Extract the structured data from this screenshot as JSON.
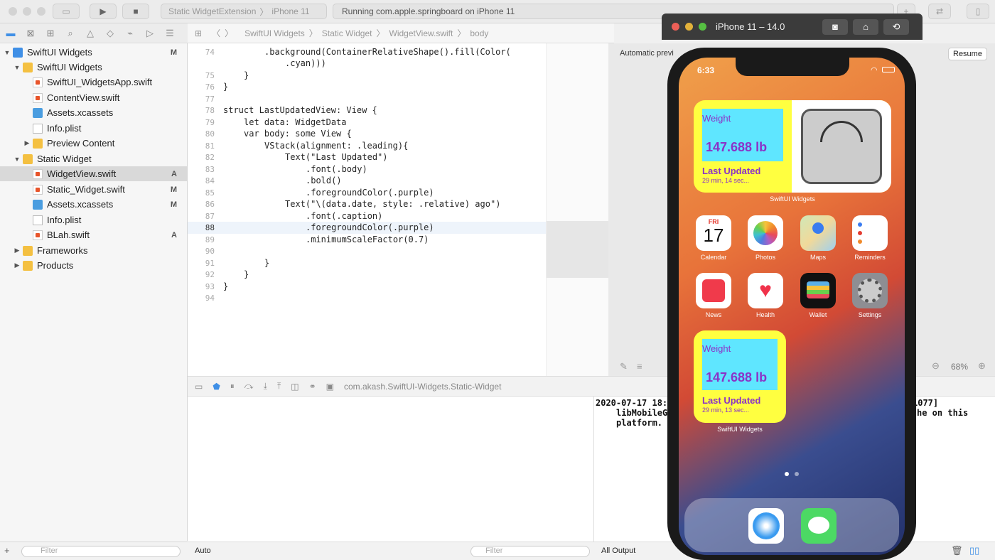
{
  "toolbar": {
    "scheme": "Static WidgetExtension",
    "device": "iPhone 11",
    "status": "Running com.apple.springboard on iPhone 11"
  },
  "navigator": {
    "items": [
      {
        "label": "SwiftUI Widgets",
        "badge": "M",
        "kind": "project"
      },
      {
        "label": "SwiftUI Widgets",
        "badge": "",
        "kind": "folder"
      },
      {
        "label": "SwiftUI_WidgetsApp.swift",
        "badge": "",
        "kind": "swift"
      },
      {
        "label": "ContentView.swift",
        "badge": "",
        "kind": "swift"
      },
      {
        "label": "Assets.xcassets",
        "badge": "",
        "kind": "asset"
      },
      {
        "label": "Info.plist",
        "badge": "",
        "kind": "plist"
      },
      {
        "label": "Preview Content",
        "badge": "",
        "kind": "folder"
      },
      {
        "label": "Static Widget",
        "badge": "",
        "kind": "folder"
      },
      {
        "label": "WidgetView.swift",
        "badge": "A",
        "kind": "swift"
      },
      {
        "label": "Static_Widget.swift",
        "badge": "M",
        "kind": "swift"
      },
      {
        "label": "Assets.xcassets",
        "badge": "M",
        "kind": "asset"
      },
      {
        "label": "Info.plist",
        "badge": "",
        "kind": "plist"
      },
      {
        "label": "BLah.swift",
        "badge": "A",
        "kind": "swift"
      },
      {
        "label": "Frameworks",
        "badge": "",
        "kind": "folder"
      },
      {
        "label": "Products",
        "badge": "",
        "kind": "folder"
      }
    ],
    "filter_placeholder": "Filter"
  },
  "jumpbar": {
    "crumbs": [
      "SwiftUI Widgets",
      "Static Widget",
      "WidgetView.swift",
      "body"
    ]
  },
  "editor": {
    "lines": [
      {
        "n": "74",
        "text": ".background(ContainerRelativeShape().fill(Color("
      },
      {
        "n": "",
        "text": ".cyan)))"
      },
      {
        "n": "75",
        "text": "}"
      },
      {
        "n": "76",
        "text": "}"
      },
      {
        "n": "77",
        "text": ""
      },
      {
        "n": "78",
        "text": "struct LastUpdatedView: View {"
      },
      {
        "n": "79",
        "text": "let data: WidgetData"
      },
      {
        "n": "80",
        "text": "var body: some View {"
      },
      {
        "n": "81",
        "text": "VStack(alignment: .leading){"
      },
      {
        "n": "82",
        "text": "Text(\"Last Updated\")"
      },
      {
        "n": "83",
        "text": ".font(.body)"
      },
      {
        "n": "84",
        "text": ".bold()"
      },
      {
        "n": "85",
        "text": ".foregroundColor(.purple)"
      },
      {
        "n": "86",
        "text": "Text(\"\\(data.date, style: .relative) ago\")"
      },
      {
        "n": "87",
        "text": ".font(.caption)"
      },
      {
        "n": "88",
        "text": ".foregroundColor(.purple)"
      },
      {
        "n": "89",
        "text": ".minimumScaleFactor(0.7)"
      },
      {
        "n": "90",
        "text": ""
      },
      {
        "n": "91",
        "text": "}"
      },
      {
        "n": "92",
        "text": "}"
      },
      {
        "n": "93",
        "text": "}"
      },
      {
        "n": "94",
        "text": ""
      }
    ]
  },
  "preview": {
    "label": "Automatic previ",
    "resume": "Resume",
    "zoom": "68%"
  },
  "debug": {
    "target": "com.akash.SwiftUI-Widgets.Static-Widget",
    "auto": "Auto",
    "filter_placeholder": "Filter",
    "output": "All Output",
    "console": [
      "2020-07-17 18:",
      "libMobileG",
      "platform."
    ],
    "console_right": [
      "1077]",
      "he on this"
    ]
  },
  "simulator": {
    "title": "iPhone 11 – 14.0",
    "time": "6:33",
    "widget_top": {
      "title": "Weight",
      "value": "147.688 lb",
      "label": "Last Updated",
      "ago": "29 min, 14 sec..."
    },
    "widget_small": {
      "title": "Weight",
      "value": "147.688 lb",
      "label": "Last Updated",
      "ago": "29 min, 13 sec..."
    },
    "widget_caption": "SwiftUI Widgets",
    "calendar_day": "FRI",
    "calendar_date": "17",
    "apps": [
      "Calendar",
      "Photos",
      "Maps",
      "Reminders",
      "News",
      "Health",
      "Wallet",
      "Settings"
    ],
    "accent": "#ffff40",
    "cyan": "#5fe6ff",
    "purple": "#8b32c7"
  }
}
